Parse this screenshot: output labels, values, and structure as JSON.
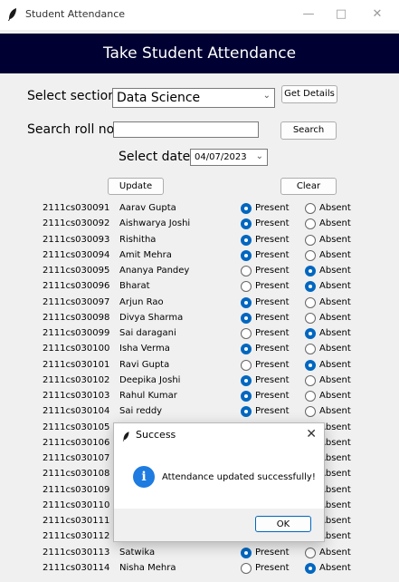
{
  "window": {
    "title": "Student Attendance"
  },
  "header": {
    "title": "Take Student Attendance"
  },
  "form": {
    "section_label": "Select section:",
    "section_value": "Data Science",
    "get_details_label": "Get Details",
    "search_label": "Search roll no:",
    "search_value": "",
    "search_button_label": "Search",
    "date_label": "Select date:",
    "date_value": "04/07/2023",
    "update_label": "Update",
    "clear_label": "Clear"
  },
  "radio_labels": {
    "present": "Present",
    "absent": "Absent"
  },
  "students": [
    {
      "roll": "2111cs030091",
      "name": "Aarav Gupta",
      "status": "present"
    },
    {
      "roll": "2111cs030092",
      "name": "Aishwarya Joshi",
      "status": "present"
    },
    {
      "roll": "2111cs030093",
      "name": "Rishitha",
      "status": "present"
    },
    {
      "roll": "2111cs030094",
      "name": "Amit Mehra",
      "status": "present"
    },
    {
      "roll": "2111cs030095",
      "name": "Ananya Pandey",
      "status": "absent"
    },
    {
      "roll": "2111cs030096",
      "name": "Bharat",
      "status": "absent"
    },
    {
      "roll": "2111cs030097",
      "name": "Arjun Rao",
      "status": "present"
    },
    {
      "roll": "2111cs030098",
      "name": "Divya Sharma",
      "status": "present"
    },
    {
      "roll": "2111cs030099",
      "name": "Sai daragani",
      "status": "absent"
    },
    {
      "roll": "2111cs030100",
      "name": "Isha Verma",
      "status": "present"
    },
    {
      "roll": "2111cs030101",
      "name": "Ravi Gupta",
      "status": "absent"
    },
    {
      "roll": "2111cs030102",
      "name": "Deepika Joshi",
      "status": "present"
    },
    {
      "roll": "2111cs030103",
      "name": "Rahul Kumar",
      "status": "present"
    },
    {
      "roll": "2111cs030104",
      "name": "Sai reddy",
      "status": "present"
    },
    {
      "roll": "2111cs030105",
      "name": "",
      "status": "absent"
    },
    {
      "roll": "2111cs030106",
      "name": "",
      "status": "absent"
    },
    {
      "roll": "2111cs030107",
      "name": "",
      "status": "absent"
    },
    {
      "roll": "2111cs030108",
      "name": "",
      "status": "absent"
    },
    {
      "roll": "2111cs030109",
      "name": "",
      "status": "absent"
    },
    {
      "roll": "2111cs030110",
      "name": "",
      "status": "absent"
    },
    {
      "roll": "2111cs030111",
      "name": "",
      "status": "absent"
    },
    {
      "roll": "2111cs030112",
      "name": "",
      "status": "absent"
    },
    {
      "roll": "2111cs030113",
      "name": "Satwika",
      "status": "present"
    },
    {
      "roll": "2111cs030114",
      "name": "Nisha Mehra",
      "status": "absent"
    }
  ],
  "dialog": {
    "title": "Success",
    "message": "Attendance updated successfully!",
    "ok_label": "OK",
    "close_glyph": "✕",
    "info_glyph": "i"
  },
  "colors": {
    "header_bg": "#000033",
    "radio_selected": "#0067c0"
  }
}
